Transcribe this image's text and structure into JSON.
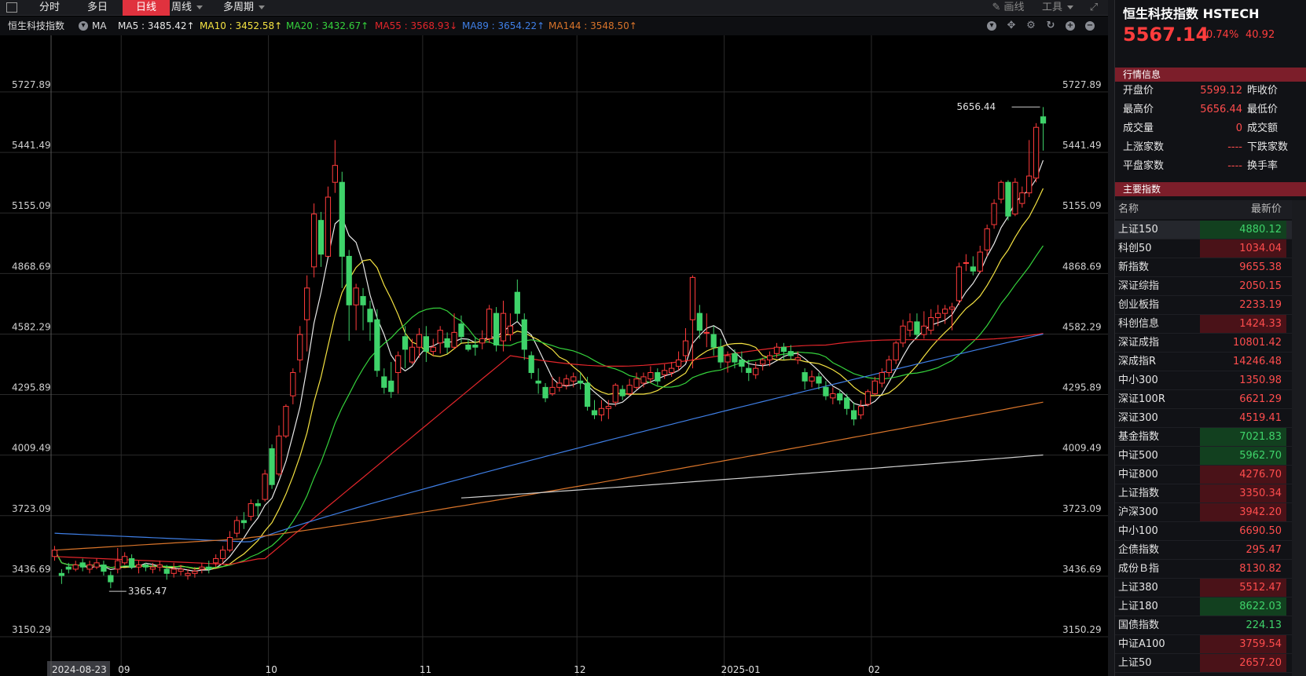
{
  "toolbar": {
    "tabs": [
      {
        "label": "分时",
        "active": false
      },
      {
        "label": "多日",
        "active": false
      },
      {
        "label": "日线",
        "active": true
      },
      {
        "label": "周线",
        "active": false,
        "dropdown": true
      },
      {
        "label": "多周期",
        "active": false,
        "dropdown": true
      }
    ],
    "draw_label": "画线",
    "tools_label": "工具"
  },
  "ma_bar": {
    "index_name": "恒生科技指数",
    "ma_label": "MA",
    "items": [
      {
        "text": "MA5 : 3485.42↑",
        "color": "#e8e8e8"
      },
      {
        "text": "MA10 : 3452.58↑",
        "color": "#f5e342"
      },
      {
        "text": "MA20 : 3432.67↑",
        "color": "#35d23c"
      },
      {
        "text": "MA55 : 3568.93↓",
        "color": "#e3262b"
      },
      {
        "text": "MA89 : 3654.22↑",
        "color": "#3f7fe6"
      },
      {
        "text": "MA144 : 3548.50↑",
        "color": "#d8742a"
      }
    ]
  },
  "chart_data": {
    "type": "candlestick",
    "y_ticks": [
      "5727.89",
      "5441.49",
      "5155.09",
      "4868.69",
      "4582.29",
      "4295.89",
      "4009.49",
      "3723.09",
      "3436.69",
      "3150.29"
    ],
    "x_labels": [
      "2024-08-23",
      "09",
      "10",
      "11",
      "12",
      "2025-01",
      "02"
    ],
    "annotations": [
      {
        "text": "5656.44"
      },
      {
        "text": "3365.47"
      }
    ],
    "ylim": [
      3000,
      5880
    ],
    "candles": [
      [
        3530,
        3560,
        3510,
        3580
      ],
      [
        3450,
        3440,
        3400,
        3470
      ],
      [
        3480,
        3470,
        3450,
        3500
      ],
      [
        3470,
        3490,
        3460,
        3510
      ],
      [
        3500,
        3480,
        3460,
        3520
      ],
      [
        3470,
        3490,
        3450,
        3510
      ],
      [
        3480,
        3500,
        3470,
        3520
      ],
      [
        3490,
        3460,
        3440,
        3510
      ],
      [
        3440,
        3410,
        3380,
        3460
      ],
      [
        3470,
        3510,
        3450,
        3570
      ],
      [
        3500,
        3530,
        3490,
        3550
      ],
      [
        3520,
        3480,
        3470,
        3540
      ],
      [
        3480,
        3490,
        3450,
        3510
      ],
      [
        3490,
        3480,
        3460,
        3500
      ],
      [
        3470,
        3480,
        3450,
        3500
      ],
      [
        3480,
        3490,
        3460,
        3510
      ],
      [
        3470,
        3450,
        3420,
        3490
      ],
      [
        3450,
        3470,
        3430,
        3500
      ],
      [
        3460,
        3470,
        3440,
        3490
      ],
      [
        3440,
        3450,
        3420,
        3470
      ],
      [
        3450,
        3460,
        3430,
        3480
      ],
      [
        3470,
        3480,
        3450,
        3500
      ],
      [
        3480,
        3470,
        3450,
        3510
      ],
      [
        3500,
        3520,
        3480,
        3540
      ],
      [
        3520,
        3560,
        3500,
        3580
      ],
      [
        3560,
        3620,
        3550,
        3650
      ],
      [
        3640,
        3700,
        3620,
        3720
      ],
      [
        3700,
        3690,
        3660,
        3740
      ],
      [
        3720,
        3780,
        3700,
        3800
      ],
      [
        3780,
        3770,
        3720,
        3800
      ],
      [
        3800,
        3920,
        3790,
        3940
      ],
      [
        4040,
        3870,
        3850,
        4060
      ],
      [
        3920,
        4100,
        3910,
        4150
      ],
      [
        4100,
        4240,
        4090,
        4250
      ],
      [
        4290,
        4400,
        4250,
        4420
      ],
      [
        4460,
        4580,
        4400,
        4620
      ],
      [
        4650,
        4800,
        4500,
        4860
      ],
      [
        4900,
        5150,
        4850,
        5200
      ],
      [
        5120,
        4960,
        4900,
        5160
      ],
      [
        4950,
        5230,
        4950,
        5280
      ],
      [
        5300,
        5380,
        5250,
        5500
      ],
      [
        5300,
        4950,
        4800,
        5350
      ],
      [
        4950,
        4720,
        4550,
        4980
      ],
      [
        4720,
        4800,
        4600,
        4820
      ],
      [
        4760,
        4720,
        4600,
        4800
      ],
      [
        4700,
        4640,
        4550,
        4740
      ],
      [
        4650,
        4410,
        4380,
        4700
      ],
      [
        4380,
        4330,
        4300,
        4420
      ],
      [
        4360,
        4310,
        4280,
        4450
      ],
      [
        4400,
        4480,
        4300,
        4500
      ],
      [
        4570,
        4510,
        4420,
        4620
      ],
      [
        4450,
        4520,
        4440,
        4560
      ],
      [
        4520,
        4580,
        4470,
        4610
      ],
      [
        4570,
        4500,
        4450,
        4620
      ],
      [
        4500,
        4520,
        4480,
        4560
      ],
      [
        4540,
        4600,
        4490,
        4620
      ],
      [
        4560,
        4520,
        4490,
        4590
      ],
      [
        4520,
        4590,
        4510,
        4680
      ],
      [
        4630,
        4570,
        4540,
        4670
      ],
      [
        4530,
        4510,
        4500,
        4560
      ],
      [
        4530,
        4520,
        4480,
        4570
      ],
      [
        4540,
        4560,
        4510,
        4600
      ],
      [
        4560,
        4700,
        4540,
        4720
      ],
      [
        4680,
        4530,
        4500,
        4710
      ],
      [
        4550,
        4680,
        4500,
        4740
      ],
      [
        4580,
        4620,
        4550,
        4680
      ],
      [
        4780,
        4680,
        4640,
        4840
      ],
      [
        4650,
        4510,
        4460,
        4680
      ],
      [
        4480,
        4400,
        4370,
        4500
      ],
      [
        4360,
        4350,
        4300,
        4420
      ],
      [
        4330,
        4280,
        4260,
        4350
      ],
      [
        4300,
        4330,
        4290,
        4380
      ],
      [
        4330,
        4350,
        4310,
        4380
      ],
      [
        4340,
        4370,
        4320,
        4390
      ],
      [
        4360,
        4380,
        4330,
        4400
      ],
      [
        4360,
        4350,
        4320,
        4400
      ],
      [
        4350,
        4240,
        4220,
        4380
      ],
      [
        4220,
        4200,
        4180,
        4270
      ],
      [
        4200,
        4230,
        4170,
        4270
      ],
      [
        4230,
        4240,
        4180,
        4270
      ],
      [
        4260,
        4340,
        4240,
        4350
      ],
      [
        4320,
        4290,
        4270,
        4340
      ],
      [
        4300,
        4340,
        4290,
        4370
      ],
      [
        4330,
        4370,
        4320,
        4400
      ],
      [
        4350,
        4380,
        4330,
        4400
      ],
      [
        4370,
        4400,
        4350,
        4430
      ],
      [
        4400,
        4360,
        4340,
        4420
      ],
      [
        4390,
        4410,
        4370,
        4440
      ],
      [
        4400,
        4420,
        4380,
        4450
      ],
      [
        4430,
        4460,
        4410,
        4500
      ],
      [
        4480,
        4550,
        4450,
        4610
      ],
      [
        4650,
        4850,
        4420,
        4860
      ],
      [
        4680,
        4600,
        4560,
        4720
      ],
      [
        4590,
        4590,
        4520,
        4680
      ],
      [
        4580,
        4520,
        4480,
        4620
      ],
      [
        4520,
        4450,
        4420,
        4560
      ],
      [
        4450,
        4480,
        4400,
        4500
      ],
      [
        4490,
        4450,
        4420,
        4510
      ],
      [
        4460,
        4430,
        4400,
        4500
      ],
      [
        4420,
        4400,
        4360,
        4460
      ],
      [
        4390,
        4420,
        4370,
        4450
      ],
      [
        4440,
        4460,
        4410,
        4470
      ],
      [
        4460,
        4480,
        4430,
        4500
      ],
      [
        4490,
        4520,
        4470,
        4540
      ],
      [
        4520,
        4500,
        4460,
        4540
      ],
      [
        4500,
        4480,
        4460,
        4530
      ],
      [
        4460,
        4470,
        4440,
        4500
      ],
      [
        4400,
        4360,
        4320,
        4420
      ],
      [
        4360,
        4380,
        4330,
        4410
      ],
      [
        4380,
        4350,
        4320,
        4400
      ],
      [
        4330,
        4290,
        4270,
        4360
      ],
      [
        4280,
        4300,
        4250,
        4330
      ],
      [
        4300,
        4270,
        4250,
        4320
      ],
      [
        4280,
        4230,
        4200,
        4300
      ],
      [
        4220,
        4180,
        4150,
        4260
      ],
      [
        4200,
        4240,
        4180,
        4270
      ],
      [
        4250,
        4310,
        4240,
        4320
      ],
      [
        4300,
        4360,
        4290,
        4380
      ],
      [
        4350,
        4400,
        4330,
        4420
      ],
      [
        4400,
        4460,
        4380,
        4480
      ],
      [
        4460,
        4540,
        4440,
        4550
      ],
      [
        4540,
        4620,
        4520,
        4650
      ],
      [
        4600,
        4640,
        4570,
        4680
      ],
      [
        4640,
        4580,
        4560,
        4680
      ],
      [
        4580,
        4620,
        4560,
        4690
      ],
      [
        4600,
        4660,
        4580,
        4700
      ],
      [
        4660,
        4680,
        4620,
        4720
      ],
      [
        4680,
        4700,
        4630,
        4720
      ],
      [
        4700,
        4710,
        4600,
        4730
      ],
      [
        4740,
        4900,
        4720,
        4920
      ],
      [
        4920,
        4920,
        4880,
        4960
      ],
      [
        4900,
        4880,
        4860,
        4950
      ],
      [
        4880,
        4970,
        4870,
        5000
      ],
      [
        4980,
        5080,
        4950,
        5100
      ],
      [
        5100,
        5200,
        5080,
        5220
      ],
      [
        5220,
        5300,
        5200,
        5310
      ],
      [
        5300,
        5140,
        5120,
        5310
      ],
      [
        5150,
        5300,
        5140,
        5320
      ],
      [
        5200,
        5250,
        5180,
        5280
      ],
      [
        5250,
        5330,
        5230,
        5500
      ],
      [
        5320,
        5560,
        5300,
        5580
      ],
      [
        5610,
        5580,
        5450,
        5656
      ]
    ],
    "ma_series": [
      {
        "name": "MA5",
        "color": "#e8e8e8"
      },
      {
        "name": "MA10",
        "color": "#f5e342"
      },
      {
        "name": "MA20",
        "color": "#35d23c"
      },
      {
        "name": "MA55",
        "color": "#e3262b"
      },
      {
        "name": "MA89",
        "color": "#3f7fe6"
      },
      {
        "name": "MA144",
        "color": "#d8742a"
      },
      {
        "name": "MA250",
        "color": "#d0d0d0"
      }
    ]
  },
  "panel": {
    "title": "恒生科技指数 HSTECH",
    "price": "5567.14",
    "change_pct": "0.74%",
    "change": "40.92",
    "quote_section": "行情信息",
    "quotes": [
      {
        "l1": "开盘价",
        "v1": "5599.12",
        "l2": "昨收价"
      },
      {
        "l1": "最高价",
        "v1": "5656.44",
        "l2": "最低价"
      },
      {
        "l1": "成交量",
        "v1": "0",
        "l2": "成交额"
      },
      {
        "l1": "上涨家数",
        "v1": "----",
        "l2": "下跌家数"
      },
      {
        "l1": "平盘家数",
        "v1": "----",
        "l2": "换手率"
      }
    ],
    "index_section": "主要指数",
    "table_head": {
      "name": "名称",
      "price": "最新价"
    },
    "rows": [
      {
        "name": "上证150",
        "value": "4880.12",
        "dir": "dn",
        "bg": "dn"
      },
      {
        "name": "科创50",
        "value": "1034.04",
        "dir": "up",
        "bg": "up"
      },
      {
        "name": "新指数",
        "value": "9655.38",
        "dir": "up",
        "bg": ""
      },
      {
        "name": "深证综指",
        "value": "2050.15",
        "dir": "up",
        "bg": ""
      },
      {
        "name": "创业板指",
        "value": "2233.19",
        "dir": "up",
        "bg": ""
      },
      {
        "name": "科创信息",
        "value": "1424.33",
        "dir": "up",
        "bg": "up"
      },
      {
        "name": "深证成指",
        "value": "10801.42",
        "dir": "up",
        "bg": ""
      },
      {
        "name": "深成指R",
        "value": "14246.48",
        "dir": "up",
        "bg": ""
      },
      {
        "name": "中小300",
        "value": "1350.98",
        "dir": "up",
        "bg": ""
      },
      {
        "name": "深证100R",
        "value": "6621.29",
        "dir": "up",
        "bg": ""
      },
      {
        "name": "深证300",
        "value": "4519.41",
        "dir": "up",
        "bg": ""
      },
      {
        "name": "基金指数",
        "value": "7021.83",
        "dir": "dn",
        "bg": "dn"
      },
      {
        "name": "中证500",
        "value": "5962.70",
        "dir": "dn",
        "bg": "dn"
      },
      {
        "name": "中证800",
        "value": "4276.70",
        "dir": "up",
        "bg": "up"
      },
      {
        "name": "上证指数",
        "value": "3350.34",
        "dir": "up",
        "bg": "up"
      },
      {
        "name": "沪深300",
        "value": "3942.20",
        "dir": "up",
        "bg": "up"
      },
      {
        "name": "中小100",
        "value": "6690.50",
        "dir": "up",
        "bg": ""
      },
      {
        "name": "企债指数",
        "value": "295.47",
        "dir": "up",
        "bg": ""
      },
      {
        "name": "成份Ｂ指",
        "value": "8130.82",
        "dir": "up",
        "bg": ""
      },
      {
        "name": "上证380",
        "value": "5512.47",
        "dir": "up",
        "bg": "up"
      },
      {
        "name": "上证180",
        "value": "8622.03",
        "dir": "dn",
        "bg": "dn"
      },
      {
        "name": "国债指数",
        "value": "224.13",
        "dir": "dn",
        "bg": ""
      },
      {
        "name": "中证A100",
        "value": "3759.54",
        "dir": "up",
        "bg": "up"
      },
      {
        "name": "上证50",
        "value": "2657.20",
        "dir": "up",
        "bg": "up"
      }
    ]
  }
}
